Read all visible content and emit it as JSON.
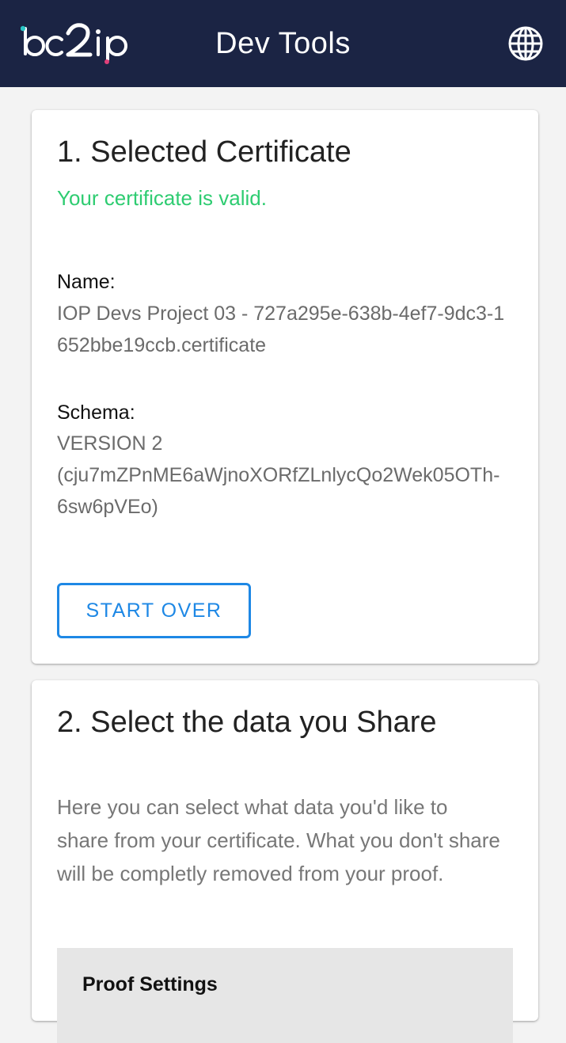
{
  "appbar": {
    "logo_text": "bc2ip",
    "title": "Dev Tools",
    "language_icon": "globe-icon"
  },
  "colors": {
    "appbar_bg": "#1b2444",
    "valid_green": "#2ecc71",
    "accent_blue": "#1e88e5",
    "logo_teal": "#29c5c5",
    "logo_pink": "#e0407a"
  },
  "certificate_card": {
    "title": "1. Selected Certificate",
    "status": "Your certificate is valid.",
    "name_label": "Name:",
    "name_value": "IOP Devs Project 03 - 727a295e-638b-4ef7-9dc3-1652bbe19ccb.certificate",
    "schema_label": "Schema:",
    "schema_version": "VERSION 2",
    "schema_id": "(cju7mZPnME6aWjnoXORfZLnlycQo2Wek05OTh-6sw6pVEo)",
    "start_over_label": "START OVER"
  },
  "share_card": {
    "title": "2. Select the data you Share",
    "description": "Here you can select what data you'd like to share from your certificate. What you don't share will be completly removed from your proof.",
    "proof_settings_title": "Proof Settings"
  }
}
